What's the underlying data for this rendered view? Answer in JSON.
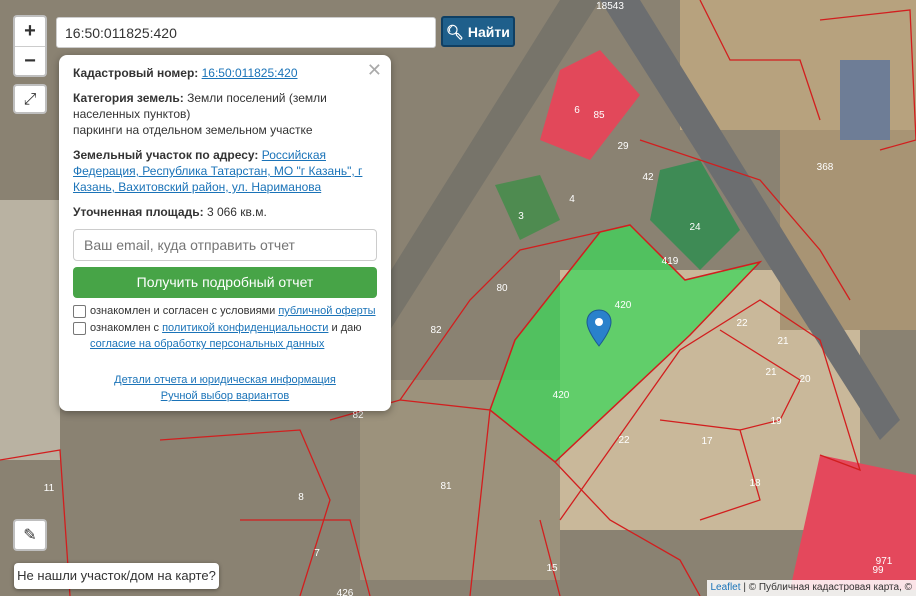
{
  "map": {
    "parcel_labels": [
      "6",
      "85",
      "29",
      "42",
      "24",
      "3",
      "4",
      "419",
      "80",
      "420",
      "420",
      "22",
      "21",
      "21",
      "20",
      "82",
      "19",
      "17",
      "18",
      "81",
      "22",
      "11",
      "8",
      "7",
      "15",
      "971",
      "99",
      "368",
      "82",
      "426",
      "18543"
    ]
  },
  "search": {
    "value": "16:50:011825:420"
  },
  "controls": {
    "zoom_in": "+",
    "zoom_out": "−",
    "find_label": "Найти"
  },
  "popup": {
    "cadastral_label": "Кадастровый номер:",
    "cadastral_value": "16:50:011825:420",
    "category_label": "Категория земель:",
    "category_value": "Земли поселений (земли населенных пунктов)",
    "use_value": "паркинги на отдельном земельном участке",
    "address_label": "Земельный участок по адресу:",
    "address_value": "Российская Федерация, Республика Татарстан, МО \"г Казань\", г Казань, Вахитовский район, ул. Нариманова",
    "area_label": "Уточненная площадь:",
    "area_value": "3 066 кв.м.",
    "email_placeholder": "Ваш email, куда отправить отчет",
    "get_report_label": "Получить подробный отчет",
    "check1_text": "ознакомлен и согласен с условиями",
    "check1_link": "публичной оферты",
    "check2_text": "ознакомлен с",
    "check2_link": "политикой конфиденциальности",
    "check2_and": "и даю",
    "check2_link2": "согласие на обработку персональных данных",
    "details_link": "Детали отчета и юридическая информация",
    "manual_link": "Ручной выбор вариантов"
  },
  "not_found_label": "Не нашли участок/дом на карте?",
  "attribution": {
    "leaflet": "Leaflet",
    "sep": "|",
    "text": "© Публичная кадастровая карта, ©"
  },
  "colors": {
    "selected_parcel": "#3dd65a",
    "parcel_border": "#d21e1e",
    "find_button": "#1f5f8b",
    "report_button": "#47a447"
  }
}
